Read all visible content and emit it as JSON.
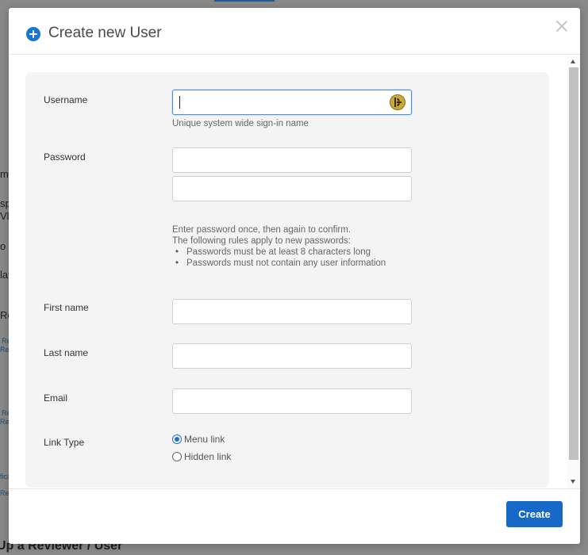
{
  "background": {
    "fragments": [
      "m",
      "sp",
      "Vla",
      "o a",
      "lat",
      "Re",
      "Re",
      "Rev",
      "Re",
      "Rev",
      "fica",
      "Rev"
    ],
    "bottom_text": "Up a Reviewer / User"
  },
  "modal": {
    "title": "Create new User",
    "title_icon": "plus-circle-icon",
    "close_icon": "close-icon"
  },
  "form": {
    "username": {
      "label": "Username",
      "value": "",
      "help": "Unique system wide sign-in name",
      "autofill_icon": "keeper-icon"
    },
    "password": {
      "label": "Password",
      "value": "",
      "confirm_value": "",
      "help_line1": "Enter password once, then again to confirm.",
      "help_line2": "The following rules apply to new passwords:",
      "rules": [
        "Passwords must be at least 8 characters long",
        "Passwords must not contain any user information"
      ]
    },
    "first_name": {
      "label": "First name",
      "value": ""
    },
    "last_name": {
      "label": "Last name",
      "value": ""
    },
    "email": {
      "label": "Email",
      "value": ""
    },
    "link_type": {
      "label": "Link Type",
      "options": [
        "Menu link",
        "Hidden link"
      ],
      "selected": "Menu link"
    }
  },
  "footer": {
    "create_label": "Create"
  },
  "colors": {
    "accent": "#1769c7",
    "panel": "#f4f4f4",
    "overlay": "#8a8a8a"
  }
}
